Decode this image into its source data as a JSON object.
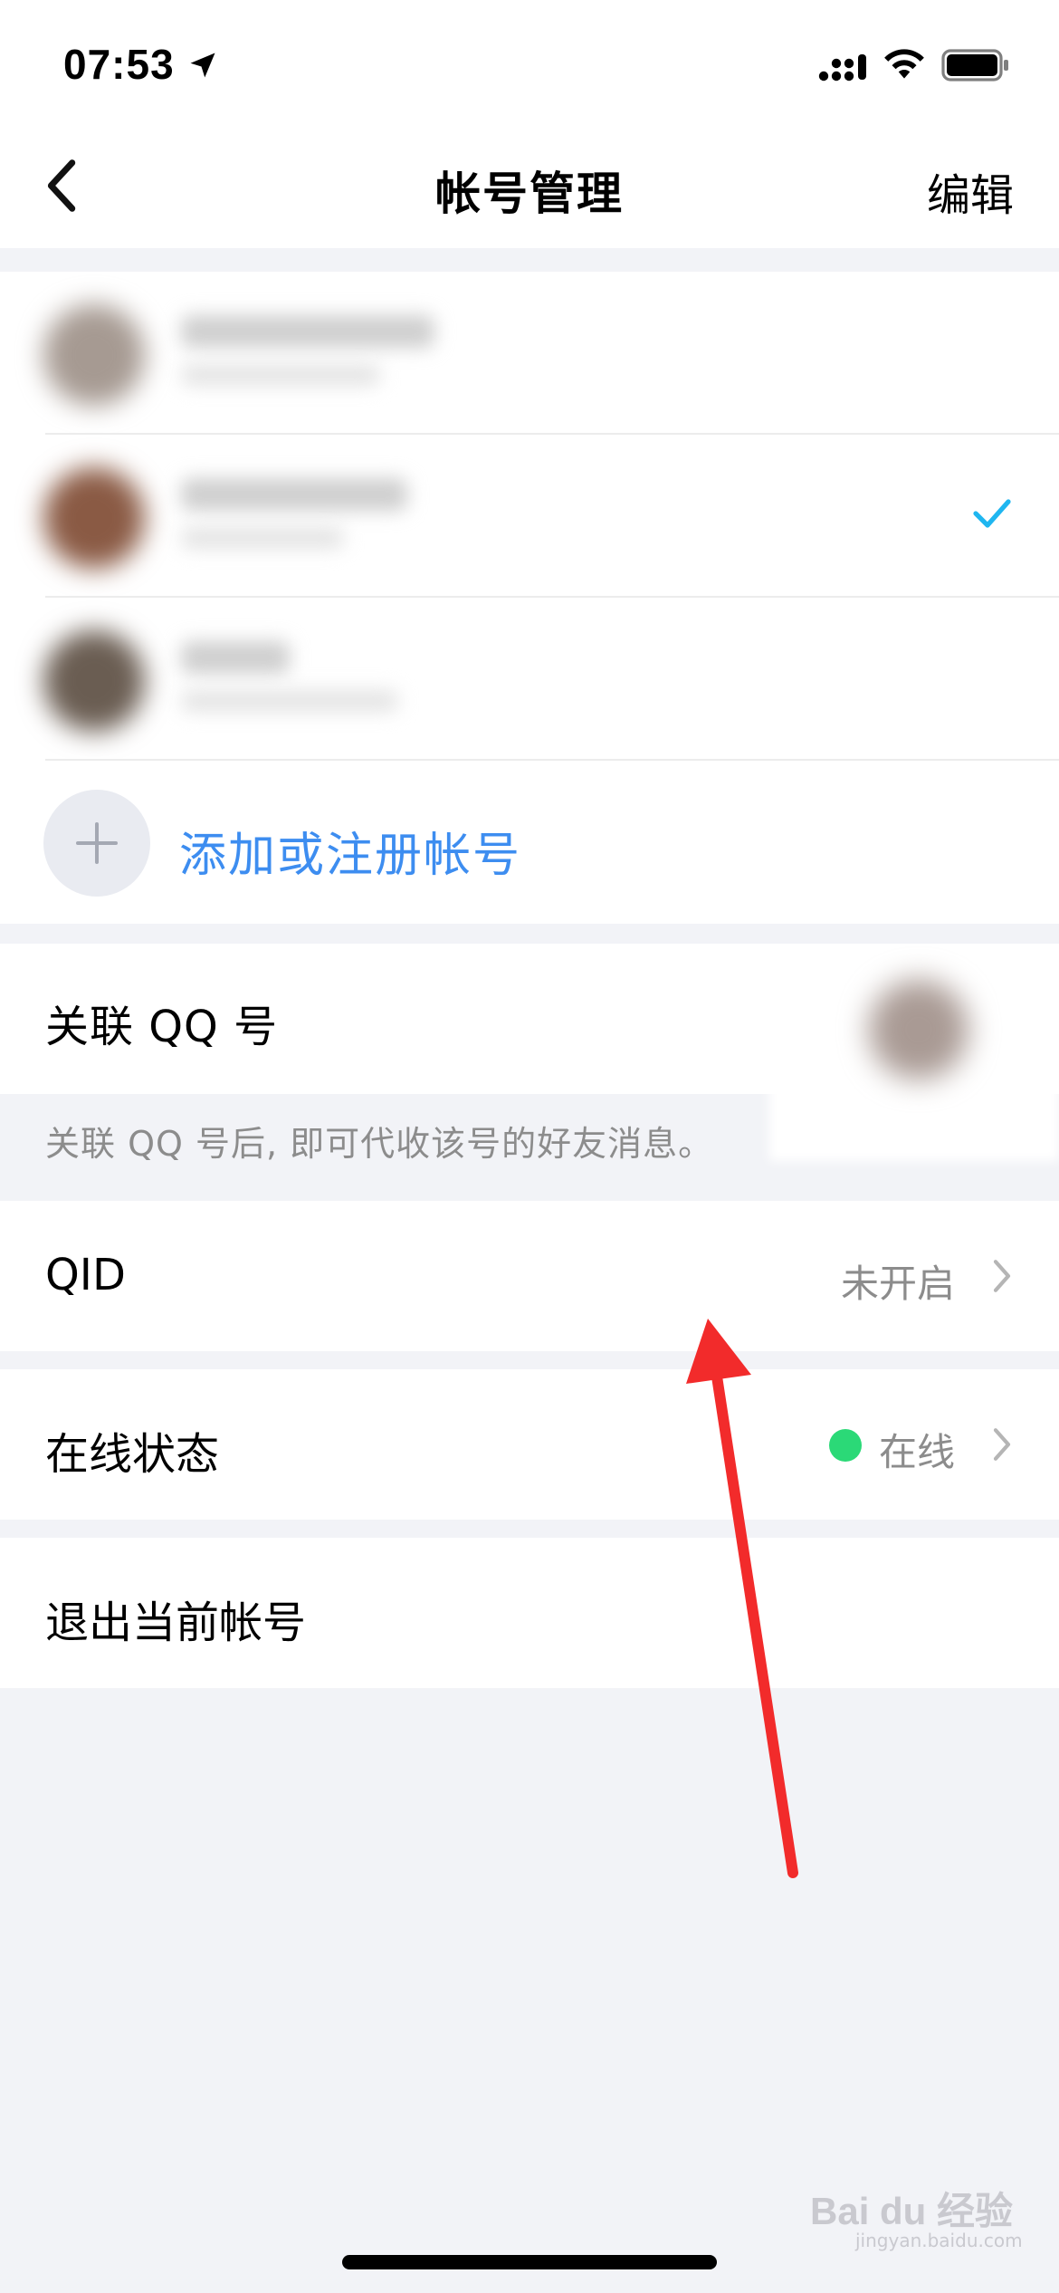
{
  "status_bar": {
    "time": "07:53",
    "icons": [
      "location-arrow-icon",
      "signal-icon",
      "wifi-icon",
      "battery-icon"
    ]
  },
  "nav": {
    "back_icon": "chevron-left-icon",
    "title": "帐号管理",
    "edit_label": "编辑"
  },
  "accounts": [
    {
      "avatar_color": "#a69a92",
      "selected": false
    },
    {
      "avatar_color": "#8a5a44",
      "selected": true
    },
    {
      "avatar_color": "#6a5d52",
      "selected": false
    }
  ],
  "add_account": {
    "icon": "plus-icon",
    "label": "添加或注册帐号"
  },
  "qq_link": {
    "label": "关联 QQ 号",
    "note": "关联 QQ 号后, 即可代收该号的好友消息。"
  },
  "qid": {
    "label": "QID",
    "value": "未开启"
  },
  "online_status": {
    "label": "在线状态",
    "value": "在线",
    "dot_color": "#2bd977"
  },
  "logout": {
    "label": "退出当前帐号"
  },
  "colors": {
    "accent": "#3d8df0",
    "check": "#1fb6f0",
    "annotation_arrow": "#f22b2b",
    "background": "#f2f3f7"
  },
  "watermark": {
    "brand": "Bai du 经验",
    "sub": "jingyan.baidu.com"
  }
}
